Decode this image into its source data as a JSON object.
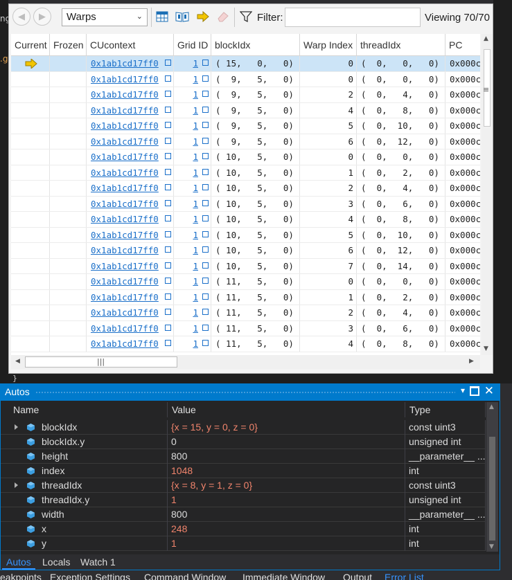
{
  "toolbar": {
    "combo_value": "Warps",
    "filter_label": "Filter:",
    "filter_value": "",
    "viewing": "Viewing 70/70"
  },
  "grid": {
    "columns": [
      "Current",
      "Frozen",
      "CUcontext",
      "Grid ID",
      "blockIdx",
      "Warp Index",
      "threadIdx",
      "PC"
    ],
    "rows": [
      {
        "current": true,
        "cucontext": "0x1ab1cd17ff0",
        "grid": "1",
        "block": "( 15,   0,   0)",
        "warp": "0",
        "thread": "(  0,   0,   0)",
        "pc": "0x000c"
      },
      {
        "current": false,
        "cucontext": "0x1ab1cd17ff0",
        "grid": "1",
        "block": "(  9,   5,   0)",
        "warp": "0",
        "thread": "(  0,   0,   0)",
        "pc": "0x000c"
      },
      {
        "current": false,
        "cucontext": "0x1ab1cd17ff0",
        "grid": "1",
        "block": "(  9,   5,   0)",
        "warp": "2",
        "thread": "(  0,   4,   0)",
        "pc": "0x000c"
      },
      {
        "current": false,
        "cucontext": "0x1ab1cd17ff0",
        "grid": "1",
        "block": "(  9,   5,   0)",
        "warp": "4",
        "thread": "(  0,   8,   0)",
        "pc": "0x000c"
      },
      {
        "current": false,
        "cucontext": "0x1ab1cd17ff0",
        "grid": "1",
        "block": "(  9,   5,   0)",
        "warp": "5",
        "thread": "(  0,  10,   0)",
        "pc": "0x000c"
      },
      {
        "current": false,
        "cucontext": "0x1ab1cd17ff0",
        "grid": "1",
        "block": "(  9,   5,   0)",
        "warp": "6",
        "thread": "(  0,  12,   0)",
        "pc": "0x000c"
      },
      {
        "current": false,
        "cucontext": "0x1ab1cd17ff0",
        "grid": "1",
        "block": "( 10,   5,   0)",
        "warp": "0",
        "thread": "(  0,   0,   0)",
        "pc": "0x000c"
      },
      {
        "current": false,
        "cucontext": "0x1ab1cd17ff0",
        "grid": "1",
        "block": "( 10,   5,   0)",
        "warp": "1",
        "thread": "(  0,   2,   0)",
        "pc": "0x000c"
      },
      {
        "current": false,
        "cucontext": "0x1ab1cd17ff0",
        "grid": "1",
        "block": "( 10,   5,   0)",
        "warp": "2",
        "thread": "(  0,   4,   0)",
        "pc": "0x000c"
      },
      {
        "current": false,
        "cucontext": "0x1ab1cd17ff0",
        "grid": "1",
        "block": "( 10,   5,   0)",
        "warp": "3",
        "thread": "(  0,   6,   0)",
        "pc": "0x000c"
      },
      {
        "current": false,
        "cucontext": "0x1ab1cd17ff0",
        "grid": "1",
        "block": "( 10,   5,   0)",
        "warp": "4",
        "thread": "(  0,   8,   0)",
        "pc": "0x000c"
      },
      {
        "current": false,
        "cucontext": "0x1ab1cd17ff0",
        "grid": "1",
        "block": "( 10,   5,   0)",
        "warp": "5",
        "thread": "(  0,  10,   0)",
        "pc": "0x000c"
      },
      {
        "current": false,
        "cucontext": "0x1ab1cd17ff0",
        "grid": "1",
        "block": "( 10,   5,   0)",
        "warp": "6",
        "thread": "(  0,  12,   0)",
        "pc": "0x000c"
      },
      {
        "current": false,
        "cucontext": "0x1ab1cd17ff0",
        "grid": "1",
        "block": "( 10,   5,   0)",
        "warp": "7",
        "thread": "(  0,  14,   0)",
        "pc": "0x000c"
      },
      {
        "current": false,
        "cucontext": "0x1ab1cd17ff0",
        "grid": "1",
        "block": "( 11,   5,   0)",
        "warp": "0",
        "thread": "(  0,   0,   0)",
        "pc": "0x000c"
      },
      {
        "current": false,
        "cucontext": "0x1ab1cd17ff0",
        "grid": "1",
        "block": "( 11,   5,   0)",
        "warp": "1",
        "thread": "(  0,   2,   0)",
        "pc": "0x000c"
      },
      {
        "current": false,
        "cucontext": "0x1ab1cd17ff0",
        "grid": "1",
        "block": "( 11,   5,   0)",
        "warp": "2",
        "thread": "(  0,   4,   0)",
        "pc": "0x000c"
      },
      {
        "current": false,
        "cucontext": "0x1ab1cd17ff0",
        "grid": "1",
        "block": "( 11,   5,   0)",
        "warp": "3",
        "thread": "(  0,   6,   0)",
        "pc": "0x000c"
      },
      {
        "current": false,
        "cucontext": "0x1ab1cd17ff0",
        "grid": "1",
        "block": "( 11,   5,   0)",
        "warp": "4",
        "thread": "(  0,   8,   0)",
        "pc": "0x000c"
      }
    ]
  },
  "autos": {
    "title": "Autos",
    "columns": [
      "Name",
      "Value",
      "Type"
    ],
    "rows": [
      {
        "name": "blockIdx",
        "value": "{x = 15, y = 0, z = 0}",
        "type": "const uint3",
        "expandable": true,
        "changed": true
      },
      {
        "name": "blockIdx.y",
        "value": "0",
        "type": "unsigned int",
        "expandable": false,
        "changed": false
      },
      {
        "name": "height",
        "value": "800",
        "type": "__parameter__ ...",
        "expandable": false,
        "changed": false
      },
      {
        "name": "index",
        "value": "1048",
        "type": "int",
        "expandable": false,
        "changed": true
      },
      {
        "name": "threadIdx",
        "value": "{x = 8, y = 1, z = 0}",
        "type": "const uint3",
        "expandable": true,
        "changed": true
      },
      {
        "name": "threadIdx.y",
        "value": "1",
        "type": "unsigned int",
        "expandable": false,
        "changed": true
      },
      {
        "name": "width",
        "value": "800",
        "type": "__parameter__ ...",
        "expandable": false,
        "changed": false
      },
      {
        "name": "x",
        "value": "248",
        "type": "int",
        "expandable": false,
        "changed": true
      },
      {
        "name": "y",
        "value": "1",
        "type": "int",
        "expandable": false,
        "changed": true
      }
    ],
    "tabs": [
      "Autos",
      "Locals",
      "Watch 1"
    ]
  },
  "bottom_tabs": [
    "eakpoints",
    "Exception Settings",
    "Command Window",
    "Immediate Window",
    "Output",
    "Error List"
  ],
  "background": {
    "left_fragments": [
      "ng",
      ".g"
    ],
    "brace": "}"
  },
  "colors": {
    "accent": "#007acc",
    "link": "#1a6fc9",
    "changed_value": "#f0846c",
    "selected_row": "#cce4f7"
  }
}
